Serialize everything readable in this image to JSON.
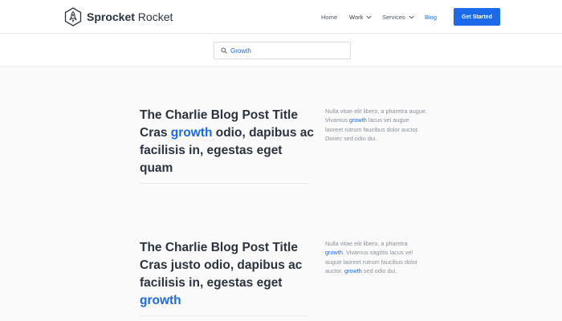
{
  "brand": {
    "bold": "Sprocket",
    "light": " Rocket"
  },
  "nav": {
    "home": "Home",
    "work": "Work",
    "services": "Services",
    "blog": "Blog",
    "cta": "Get Started"
  },
  "search": {
    "value": "Growth"
  },
  "posts": [
    {
      "title_before": "The Charlie Blog Post Title Cras ",
      "title_highlight": "growth",
      "title_after": " odio, dapibus ac facilisis in, egestas eget quam",
      "excerpt_before": "Nulla vitae elit libero, a pharetra augue. Vivamus ",
      "excerpt_highlight": "growth",
      "excerpt_after": " lacus vel augue laoreet rutrum faucibus dolor auctor. Donec sed odio dui."
    },
    {
      "title_before": "The Charlie Blog Post Title Cras justo odio, dapibus ac facilisis in, egestas eget ",
      "title_highlight": "growth",
      "excerpt_before": "Nulla vitae elit libero, a pharetra ",
      "excerpt_highlight": "growth",
      "excerpt_middle": ". Vivamus sagittis lacus vel augue laoreet rutrum faucibus dolor auctor. ",
      "excerpt_highlight_2": "growth",
      "excerpt_after": " sed odio dui."
    }
  ],
  "colors": {
    "accent": "#1a6ae9",
    "title": "#2b333f",
    "muted": "#8a929c"
  },
  "icons": [
    "rocket-logo-icon",
    "chevron-down-icon",
    "search-icon"
  ]
}
